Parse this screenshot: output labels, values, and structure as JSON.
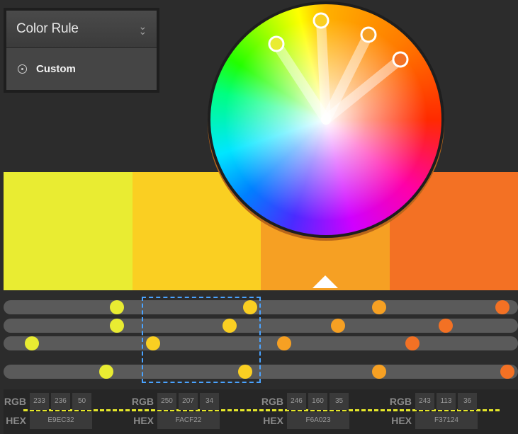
{
  "color_rule": {
    "title": "Color Rule",
    "selected": "Custom"
  },
  "swatches": [
    {
      "hex": "#E9EC32"
    },
    {
      "hex": "#FACF22"
    },
    {
      "hex": "#F6A023"
    },
    {
      "hex": "#F37124"
    }
  ],
  "sliders": {
    "rows": [
      {
        "dots": [
          {
            "pos": 0.22,
            "color": "#E9EC32"
          },
          {
            "pos": 0.48,
            "color": "#FACF22"
          },
          {
            "pos": 0.73,
            "color": "#F6A023"
          },
          {
            "pos": 0.97,
            "color": "#F37124"
          }
        ]
      },
      {
        "dots": [
          {
            "pos": 0.22,
            "color": "#E9EC32"
          },
          {
            "pos": 0.44,
            "color": "#FACF22"
          },
          {
            "pos": 0.65,
            "color": "#F6A023"
          },
          {
            "pos": 0.86,
            "color": "#F37124"
          }
        ]
      },
      {
        "dots": [
          {
            "pos": 0.055,
            "color": "#E9EC32"
          },
          {
            "pos": 0.29,
            "color": "#FACF22"
          },
          {
            "pos": 0.545,
            "color": "#F6A023"
          },
          {
            "pos": 0.795,
            "color": "#F37124"
          }
        ]
      },
      {
        "dots": [
          {
            "pos": 0.2,
            "color": "#E9EC32"
          },
          {
            "pos": 0.47,
            "color": "#FACF22"
          },
          {
            "pos": 0.73,
            "color": "#F6A023"
          },
          {
            "pos": 0.98,
            "color": "#F37124"
          }
        ]
      }
    ]
  },
  "values": {
    "rgb_label": "RGB",
    "hex_label": "HEX",
    "colors": [
      {
        "r": "233",
        "g": "236",
        "b": "50",
        "hex": "E9EC32"
      },
      {
        "r": "250",
        "g": "207",
        "b": "34",
        "hex": "FACF22"
      },
      {
        "r": "246",
        "g": "160",
        "b": "35",
        "hex": "F6A023"
      },
      {
        "r": "243",
        "g": "113",
        "b": "36",
        "hex": "F37124"
      }
    ]
  }
}
